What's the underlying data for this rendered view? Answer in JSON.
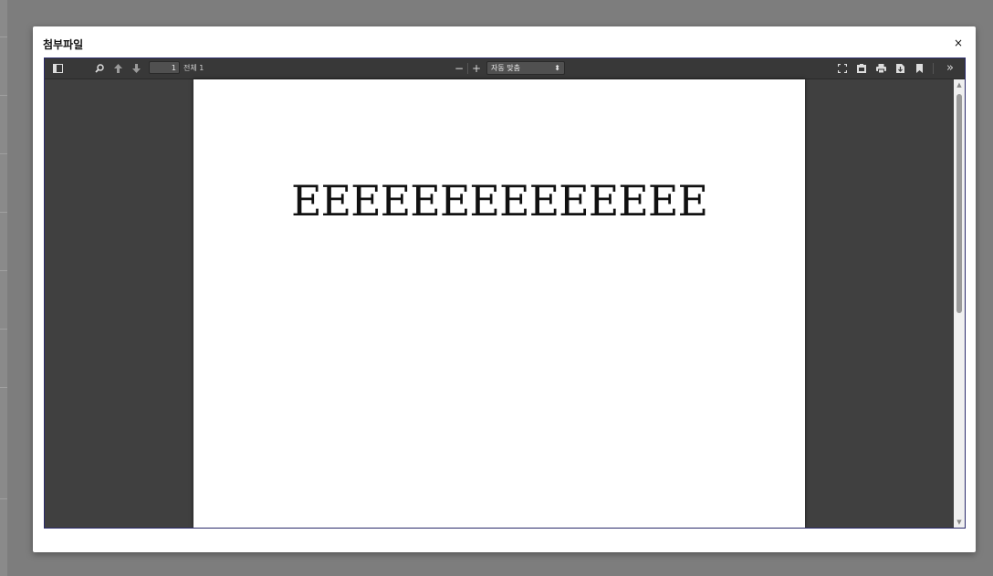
{
  "modal": {
    "title": "첨부파일",
    "close_label": "×"
  },
  "toolbar": {
    "icons": {
      "sidebar": "sidebar-toggle-icon",
      "search": "search-icon",
      "prev": "arrow-up-icon",
      "next": "arrow-down-icon",
      "zoom_out": "minus-icon",
      "zoom_in": "plus-icon",
      "presentation": "presentation-mode-icon",
      "open": "open-file-icon",
      "print": "print-icon",
      "download": "download-icon",
      "bookmark": "bookmark-icon",
      "tools": "double-chevron-right-icon"
    },
    "page_number": "1",
    "page_total": "전체 1",
    "zoom_out_label": "−",
    "zoom_in_label": "+",
    "zoom_value": "자동 맞춤",
    "zoom_caret": "⬍",
    "tools_label": "»"
  },
  "document": {
    "page_text": "EEEEEEEEEEEEEE"
  },
  "scrollbar": {
    "up_label": "▲",
    "down_label": "▼"
  },
  "colors": {
    "viewer_bg": "#404040",
    "toolbar_bg": "#383838",
    "backdrop": "#7d7d7d",
    "viewer_border": "#2b2b6b"
  }
}
